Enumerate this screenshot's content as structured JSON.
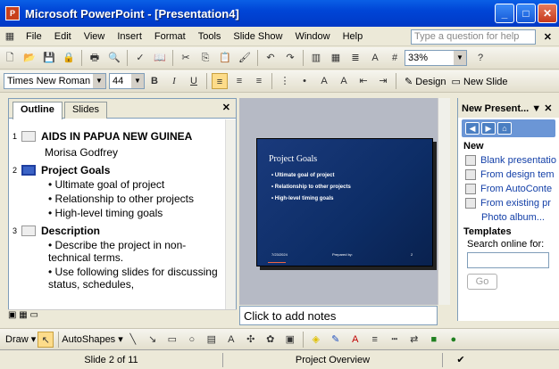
{
  "window": {
    "title": "Microsoft PowerPoint - [Presentation4]"
  },
  "menu": [
    "File",
    "Edit",
    "View",
    "Insert",
    "Format",
    "Tools",
    "Slide Show",
    "Window",
    "Help"
  ],
  "help_placeholder": "Type a question for help",
  "toolbar": {
    "zoom": "33%"
  },
  "formatbar": {
    "font": "Times New Roman",
    "size": "44",
    "bold": "B",
    "italic": "I",
    "underline": "U",
    "design": "Design",
    "new_slide": "New Slide"
  },
  "tabs": {
    "outline": "Outline",
    "slides": "Slides"
  },
  "outline": [
    {
      "num": "1",
      "title": "AIDS IN PAPUA NEW GUINEA",
      "sub": [
        "Morisa Godfrey"
      ],
      "selected": false
    },
    {
      "num": "2",
      "title": "Project Goals",
      "bullets": [
        "• Ultimate goal of project",
        "• Relationship to other projects",
        "• High-level timing goals"
      ],
      "selected": true
    },
    {
      "num": "3",
      "title": "Description",
      "bullets": [
        "• Describe the project in non-technical terms.",
        "• Use following slides for discussing status, schedules,"
      ],
      "selected": false
    }
  ],
  "slide": {
    "title": "Project Goals",
    "bullets": [
      "• Ultimate goal of project",
      "• Relationship to other projects",
      "• High-level timing goals"
    ],
    "footer_left": "7/23/2024",
    "footer_mid": "Prepared by:",
    "footer_num": "2"
  },
  "notes": "Click to add notes",
  "taskpane": {
    "title": "New Present...",
    "section_new": "New",
    "links": [
      "Blank presentatio",
      "From design tem",
      "From AutoConte",
      "From existing pr",
      "Photo album..."
    ],
    "section_templates": "Templates",
    "search_label": "Search online for:",
    "go": "Go"
  },
  "drawbar": {
    "draw": "Draw",
    "autoshapes": "AutoShapes"
  },
  "status": {
    "slide": "Slide 2 of 11",
    "design": "Project Overview"
  }
}
